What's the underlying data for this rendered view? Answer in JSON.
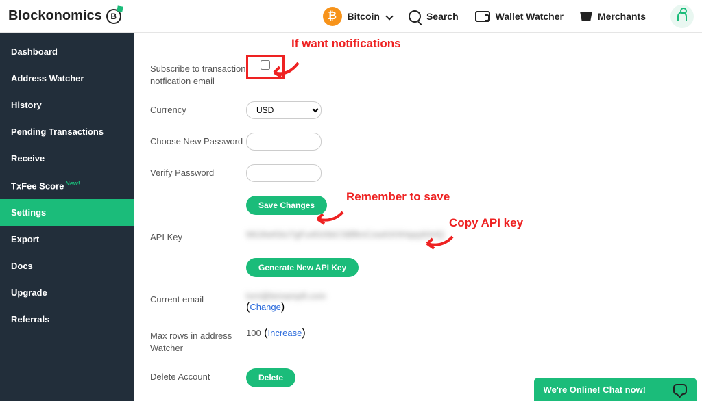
{
  "brand": "Blockonomics",
  "topnav": {
    "bitcoin": "Bitcoin",
    "search": "Search",
    "wallet_watcher": "Wallet Watcher",
    "merchants": "Merchants"
  },
  "sidebar": {
    "items": [
      {
        "label": "Dashboard"
      },
      {
        "label": "Address Watcher"
      },
      {
        "label": "History"
      },
      {
        "label": "Pending Transactions"
      },
      {
        "label": "Receive"
      },
      {
        "label": "TxFee Score",
        "badge": "New!"
      },
      {
        "label": "Settings",
        "active": true
      },
      {
        "label": "Export"
      },
      {
        "label": "Docs"
      },
      {
        "label": "Upgrade"
      },
      {
        "label": "Referrals"
      }
    ]
  },
  "form": {
    "subscribe_label": "Subscribe to transaction notfication email",
    "currency_label": "Currency",
    "currency_value": "USD",
    "new_password_label": "Choose New Password",
    "verify_password_label": "Verify Password",
    "save_btn": "Save Changes",
    "api_key_label": "API Key",
    "api_key_value": "WtJAeKbU7gFu4GiSbCSBfknCzwAXHHqaykhHQ",
    "gen_api_btn": "Generate New API Key",
    "current_email_label": "Current email",
    "current_email_value": "lorri@lemampft.com",
    "change_link": "Change",
    "max_rows_label": "Max rows in address Watcher",
    "max_rows_value": "100",
    "increase_link": "Increase",
    "delete_label": "Delete Account",
    "delete_btn": "Delete"
  },
  "annotations": {
    "a1": "If want notifications",
    "a2": "Remember to save",
    "a3": "Copy API key"
  },
  "chat": {
    "text": "We're Online! Chat now!"
  },
  "colors": {
    "accent": "#1bbc7a",
    "annotation": "#e22"
  }
}
